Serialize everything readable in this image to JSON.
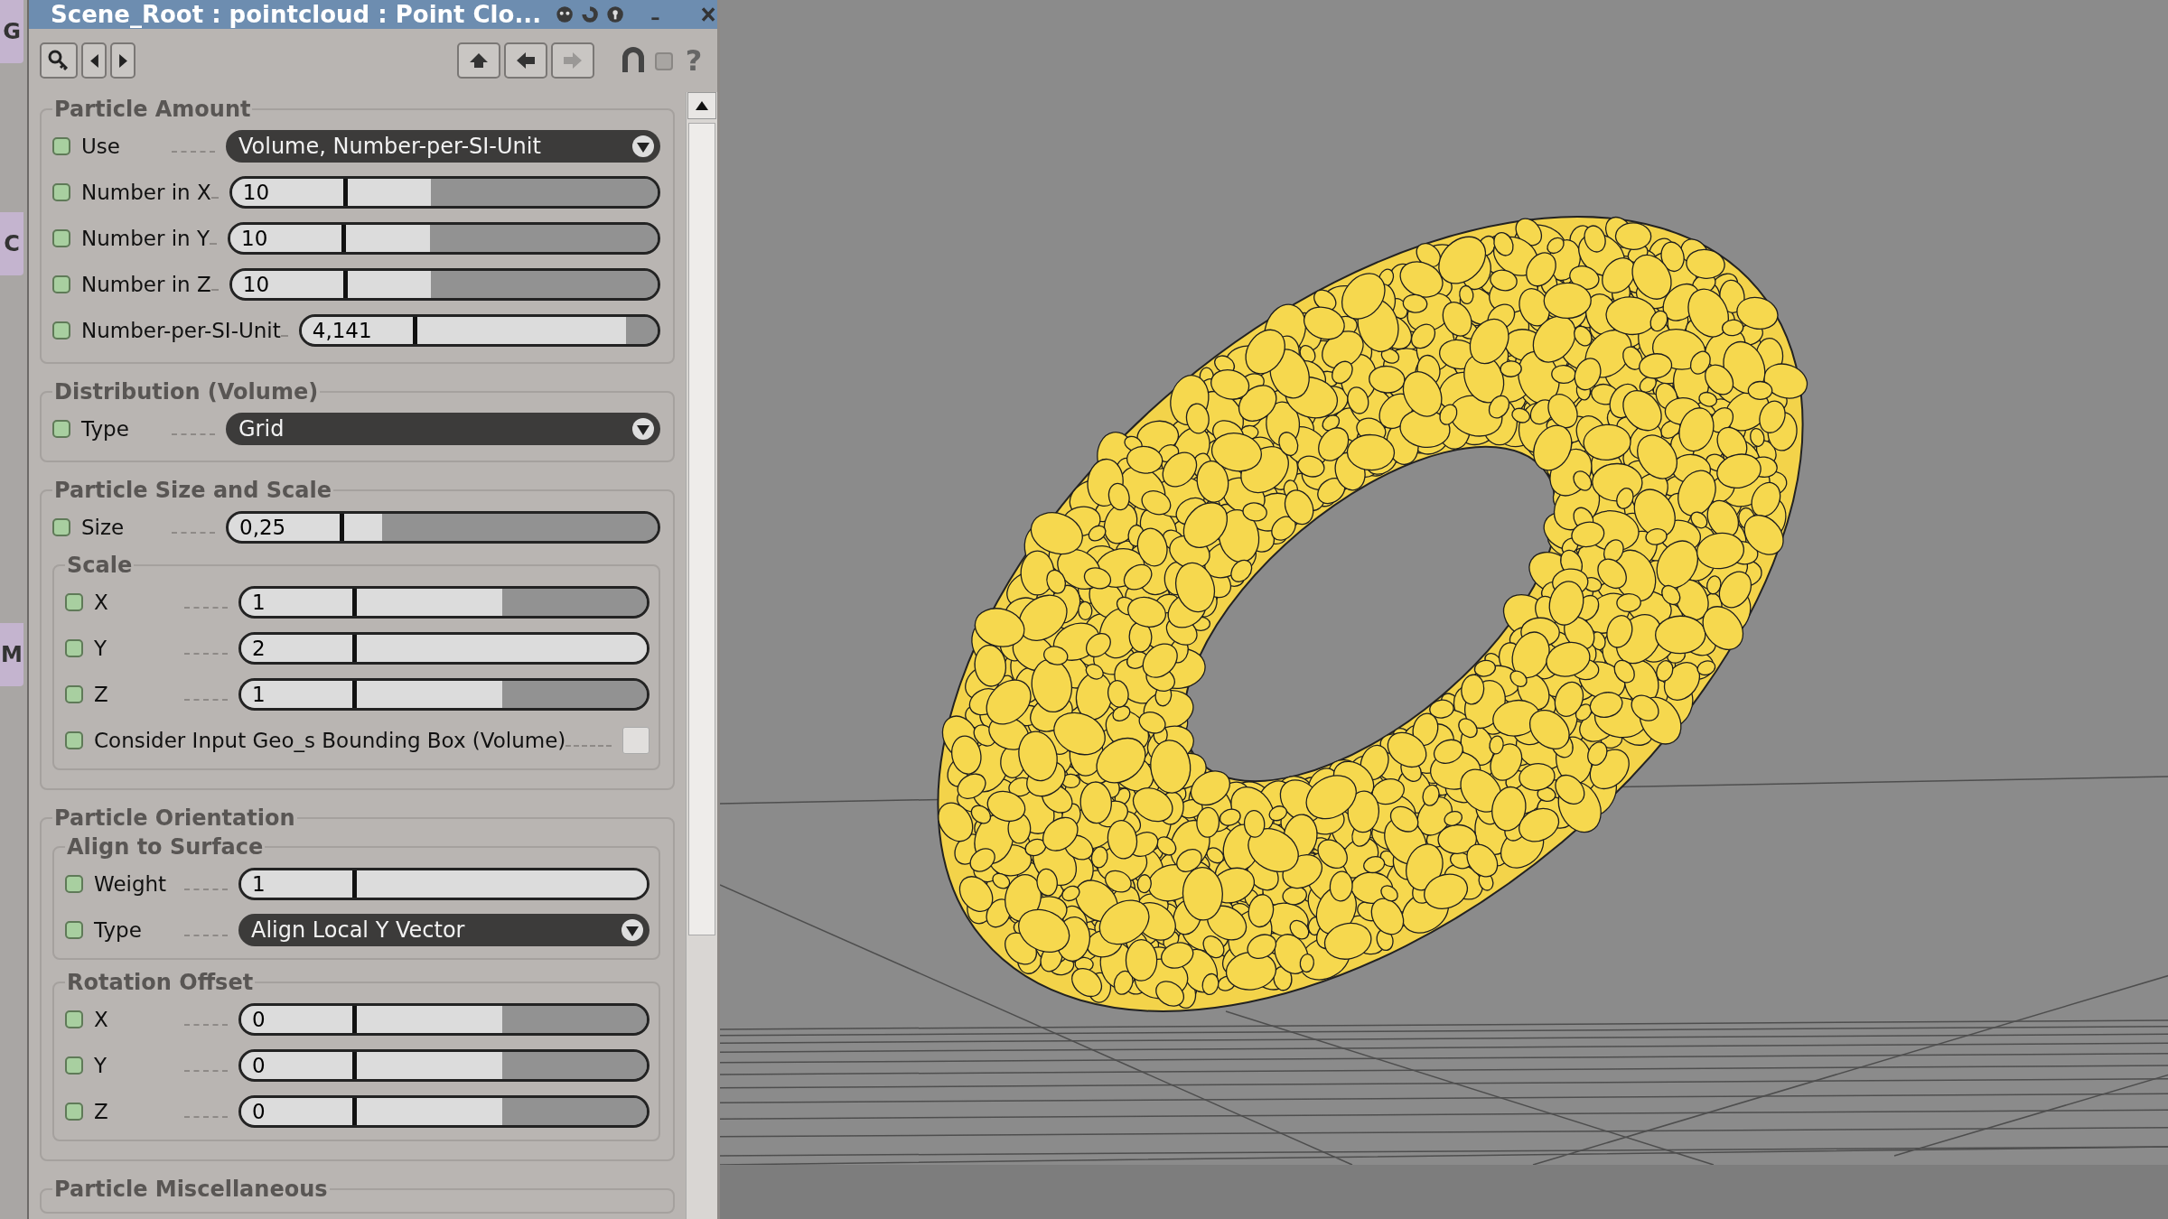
{
  "side_tabs": [
    "G",
    "C",
    "M"
  ],
  "window": {
    "title": "Scene_Root : pointcloud : Point Clo..."
  },
  "toolbar": {
    "help": "?"
  },
  "groups": [
    {
      "title": "Particle Amount",
      "rows": [
        {
          "kind": "dropdown",
          "label": "Use",
          "value": "Volume, Number-per-SI-Unit"
        },
        {
          "kind": "slider",
          "label": "Number in X",
          "value": "10",
          "level": 0.27
        },
        {
          "kind": "slider",
          "label": "Number in Y",
          "value": "10",
          "level": 0.27
        },
        {
          "kind": "slider",
          "label": "Number in Z",
          "value": "10",
          "level": 0.27
        },
        {
          "kind": "slider",
          "label": "Number-per-SI-Unit",
          "value": "4,141",
          "level": 0.87
        }
      ]
    },
    {
      "title": "Distribution (Volume)",
      "rows": [
        {
          "kind": "dropdown",
          "label": "Type",
          "value": "Grid"
        }
      ]
    },
    {
      "title": "Particle Size and Scale",
      "rows": [
        {
          "kind": "slider",
          "label": "Size",
          "value": "0,25",
          "level": 0.12
        }
      ],
      "subgroups": [
        {
          "title": "Scale",
          "rows": [
            {
              "kind": "slider",
              "label": "X",
              "value": "1",
              "level": 0.5
            },
            {
              "kind": "slider",
              "label": "Y",
              "value": "2",
              "level": 1
            },
            {
              "kind": "slider",
              "label": "Z",
              "value": "1",
              "level": 0.5
            },
            {
              "kind": "checkbox",
              "label": "Consider Input Geo_s Bounding Box (Volume)",
              "checked": false
            }
          ]
        }
      ]
    },
    {
      "title": "Particle Orientation",
      "subgroups": [
        {
          "title": "Align to Surface",
          "rows": [
            {
              "kind": "slider",
              "label": "Weight",
              "value": "1",
              "level": 1
            },
            {
              "kind": "dropdown",
              "label": "Type",
              "value": "Align Local Y Vector"
            }
          ]
        },
        {
          "title": "Rotation Offset",
          "rows": [
            {
              "kind": "slider",
              "label": "X",
              "value": "0",
              "level": 0.5
            },
            {
              "kind": "slider",
              "label": "Y",
              "value": "0",
              "level": 0.5
            },
            {
              "kind": "slider",
              "label": "Z",
              "value": "0",
              "level": 0.5
            }
          ]
        }
      ]
    },
    {
      "title": "Particle Miscellaneous"
    }
  ]
}
